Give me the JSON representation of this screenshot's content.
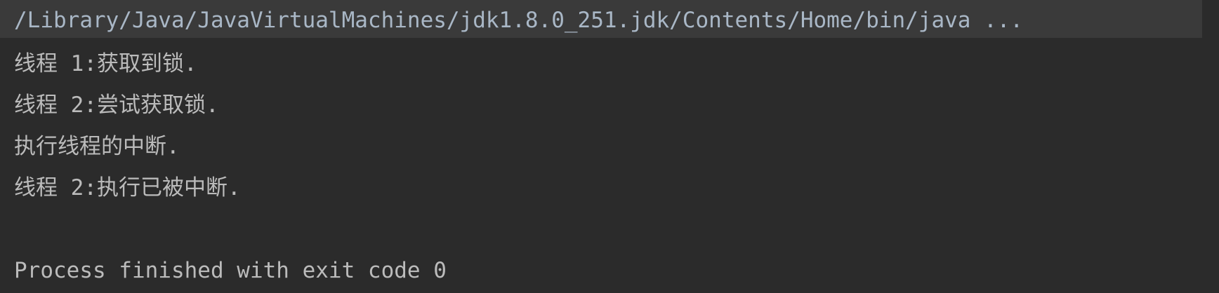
{
  "console": {
    "command": "/Library/Java/JavaVirtualMachines/jdk1.8.0_251.jdk/Contents/Home/bin/java ...",
    "lines": [
      "线程 1:获取到锁.",
      "线程 2:尝试获取锁.",
      "执行线程的中断.",
      "线程 2:执行已被中断."
    ],
    "exit_message": "Process finished with exit code 0"
  },
  "colors": {
    "background": "#2b2b2b",
    "command_background": "#3a3a3a",
    "command_text": "#a9b7c6",
    "output_text": "#bbbbbb"
  }
}
